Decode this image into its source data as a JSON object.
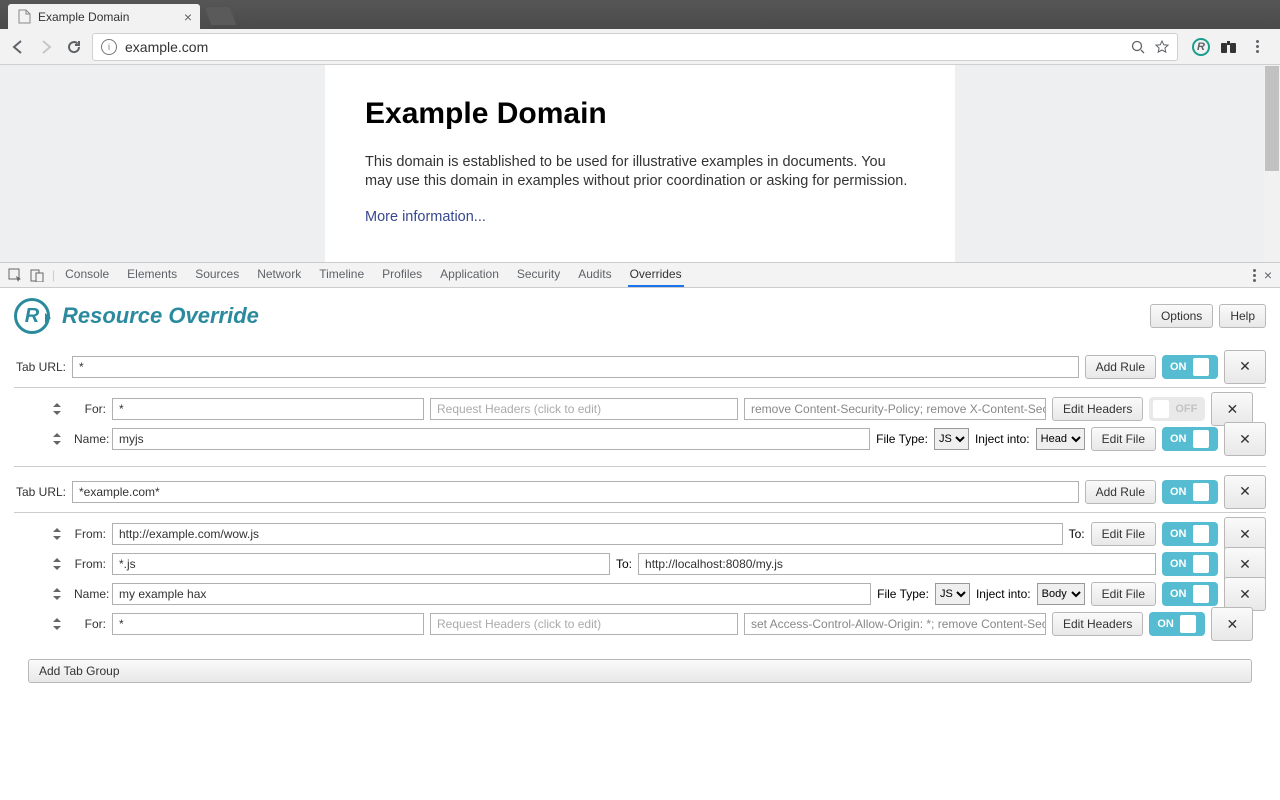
{
  "browser": {
    "tab_title": "Example Domain",
    "url": "example.com"
  },
  "page": {
    "heading": "Example Domain",
    "paragraph": "This domain is established to be used for illustrative examples in documents. You may use this domain in examples without prior coordination or asking for permission.",
    "link": "More information..."
  },
  "devtools": {
    "tabs": [
      "Console",
      "Elements",
      "Sources",
      "Network",
      "Timeline",
      "Profiles",
      "Application",
      "Security",
      "Audits",
      "Overrides"
    ],
    "active_tab": "Overrides"
  },
  "panel": {
    "title": "Resource Override",
    "options_label": "Options",
    "help_label": "Help",
    "tab_url_label": "Tab URL:",
    "add_rule_label": "Add Rule",
    "edit_headers_label": "Edit Headers",
    "edit_file_label": "Edit File",
    "for_label": "For:",
    "name_label": "Name:",
    "from_label": "From:",
    "to_label": "To:",
    "file_type_label": "File Type:",
    "inject_into_label": "Inject into:",
    "request_headers_placeholder": "Request Headers (click to edit)",
    "on_label": "ON",
    "off_label": "OFF",
    "add_tab_group_label": "Add Tab Group"
  },
  "groups": [
    {
      "tab_url": "*",
      "on": true,
      "rules": [
        {
          "type": "headers",
          "for": "*",
          "headers_summary": "remove Content-Security-Policy; remove X-Content-Security",
          "on": false
        },
        {
          "type": "file",
          "name": "myjs",
          "file_type": "JS",
          "inject_into": "Head",
          "on": true
        }
      ]
    },
    {
      "tab_url": "*example.com*",
      "on": true,
      "rules": [
        {
          "type": "from_to_file",
          "from": "http://example.com/wow.js",
          "edit_file": true,
          "on": true
        },
        {
          "type": "from_to",
          "from": "*.js",
          "to": "http://localhost:8080/my.js",
          "on": true
        },
        {
          "type": "file",
          "name": "my example hax",
          "file_type": "JS",
          "inject_into": "Body",
          "on": true
        },
        {
          "type": "headers",
          "for": "*",
          "headers_summary": "set Access-Control-Allow-Origin: *; remove Content-Security",
          "on": true
        }
      ]
    }
  ]
}
